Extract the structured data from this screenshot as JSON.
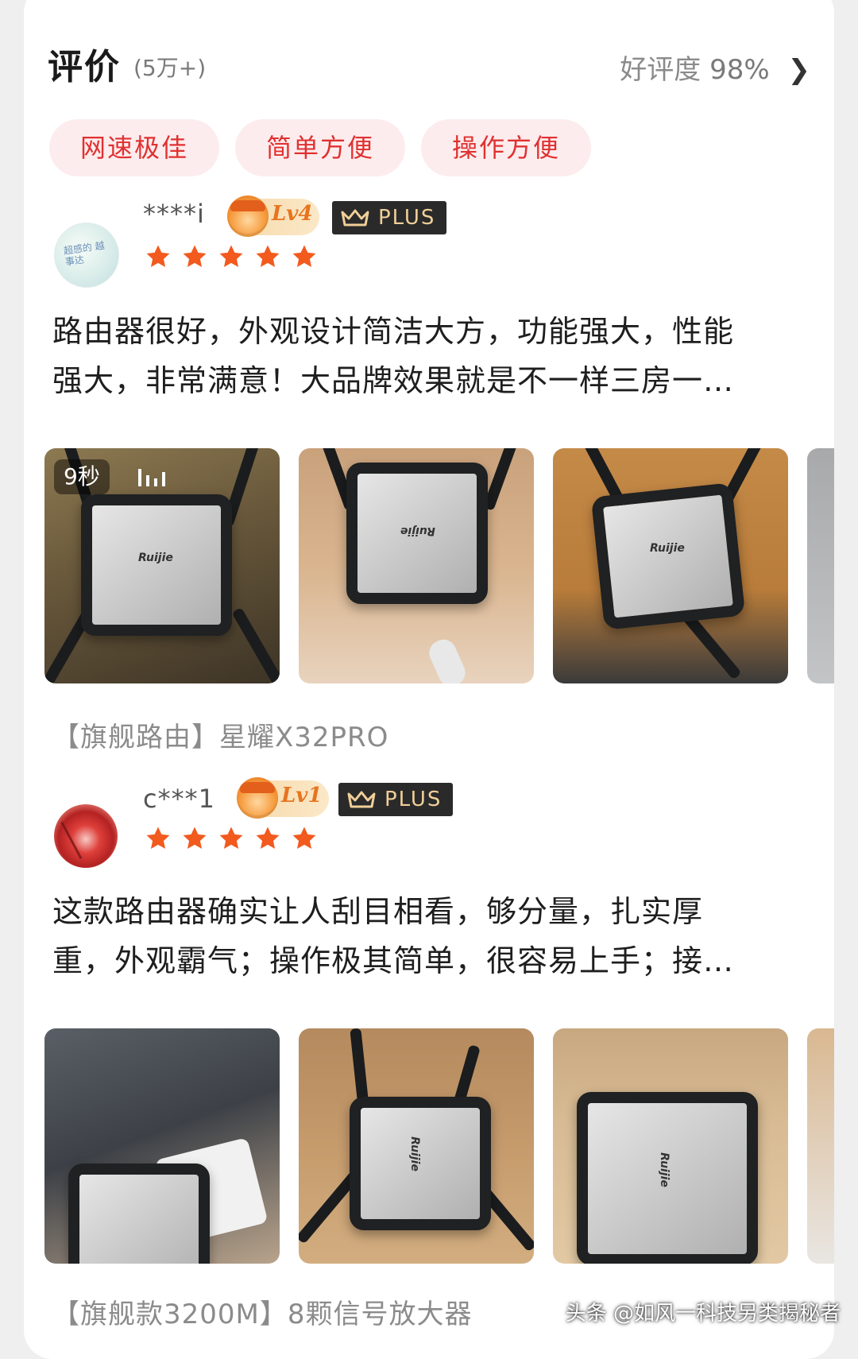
{
  "header": {
    "title": "评价",
    "count": "(5万+)",
    "rating_label": "好评度",
    "rating_value": "98%",
    "chevron": "❯"
  },
  "tags": [
    "网速极佳",
    "简单方便",
    "操作方便"
  ],
  "reviews": [
    {
      "username": "****i",
      "avatar_text": "超感的 越事达",
      "level": "Lv4",
      "plus": "PLUS",
      "stars": 5,
      "text_line1": "路由器很好，外观设计简洁大方，功能强大，性能",
      "text_line2": "强大，非常满意！大品牌效果就是不一样三房一…",
      "video_duration": "9秒",
      "variant": "【旗舰路由】星耀X32PRO"
    },
    {
      "username": "c***1",
      "level": "Lv1",
      "plus": "PLUS",
      "stars": 5,
      "text_line1": "这款路由器确实让人刮目相看，够分量，扎实厚",
      "text_line2": "重，外观霸气；操作极其简单，很容易上手；接…",
      "variant": "【旗舰款3200M】8颗信号放大器"
    }
  ],
  "photo_labels": [
    "Ruijie",
    "Ruijie",
    "Ruijie",
    "Ruijie",
    "Ruijie",
    "Ruijie"
  ],
  "watermark": "头条 @如风一科技另类揭秘者",
  "colors": {
    "accent_red": "#e03131",
    "tag_bg": "#fdeced",
    "star_orange": "#f25a1e",
    "plus_gold": "#f0cf98"
  }
}
